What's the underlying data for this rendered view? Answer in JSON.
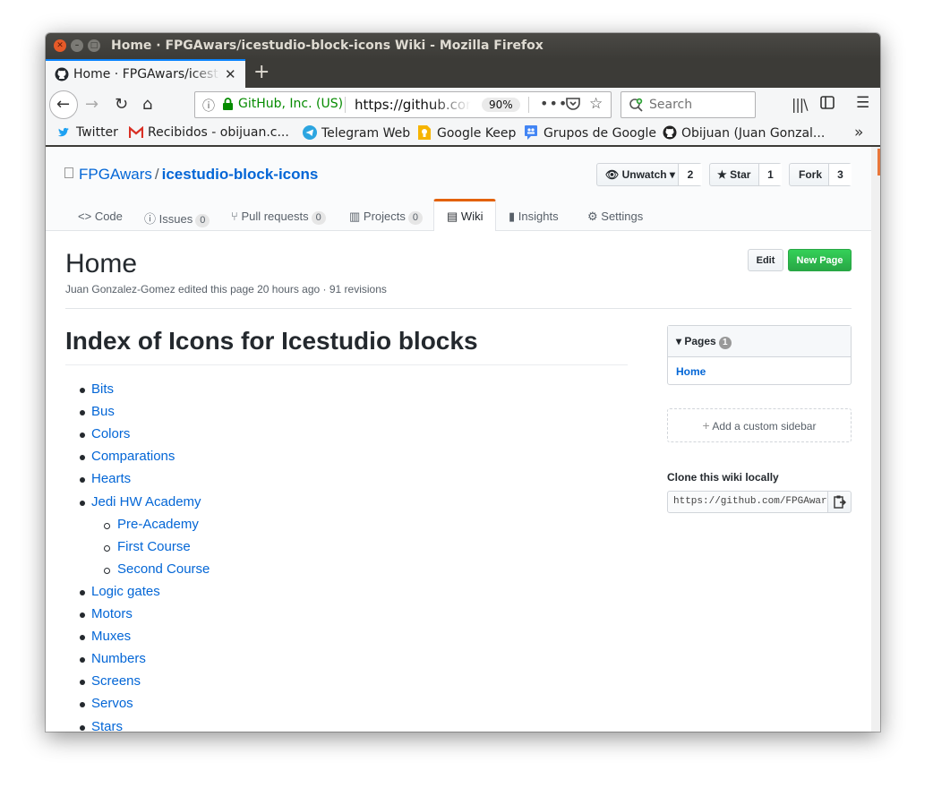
{
  "window": {
    "title": "Home · FPGAwars/icestudio-block-icons Wiki - Mozilla Firefox"
  },
  "tab": {
    "label": "Home · FPGAwars/icestudio-block-icons Wiki",
    "close_glyph": "✕",
    "new_tab_glyph": "+"
  },
  "navbar": {
    "identity": "GitHub, Inc. (US)",
    "url": "https://github.com/FPGAwars/icestudio-block-icons/wiki",
    "zoom": "90%",
    "search_placeholder": "Search"
  },
  "bookmarks": [
    {
      "label": "Twitter",
      "icon": "twitter-icon",
      "color": "#1da1f2"
    },
    {
      "label": "Recibidos - obijuan.c...",
      "icon": "gmail-icon",
      "color": "#d93025"
    },
    {
      "label": "Telegram Web",
      "icon": "telegram-icon",
      "color": "#2ca5e0"
    },
    {
      "label": "Google Keep",
      "icon": "keep-icon",
      "color": "#f6b400"
    },
    {
      "label": "Grupos de Google",
      "icon": "groups-icon",
      "color": "#4285f4"
    },
    {
      "label": "Obijuan (Juan Gonzal...",
      "icon": "github-icon",
      "color": "#222222"
    }
  ],
  "repo": {
    "owner": "FPGAwars",
    "separator": "/",
    "name": "icestudio-block-icons",
    "unwatch_label": "Unwatch ▾",
    "watch_count": "2",
    "star_label": "Star",
    "star_count": "1",
    "fork_label": "Fork",
    "fork_count": "3"
  },
  "reponav": [
    {
      "label": "Code",
      "counter": null,
      "icon": "code-icon"
    },
    {
      "label": "Issues",
      "counter": "0",
      "icon": "issue-icon"
    },
    {
      "label": "Pull requests",
      "counter": "0",
      "icon": "pull-request-icon"
    },
    {
      "label": "Projects",
      "counter": "0",
      "icon": "project-icon"
    },
    {
      "label": "Wiki",
      "counter": null,
      "icon": "book-icon",
      "selected": true
    },
    {
      "label": "Insights",
      "counter": null,
      "icon": "graph-icon"
    },
    {
      "label": "Settings",
      "counter": null,
      "icon": "gear-icon"
    }
  ],
  "page": {
    "title": "Home",
    "meta": "Juan Gonzalez-Gomez edited this page 20 hours ago · 91 revisions",
    "edit_label": "Edit",
    "new_page_label": "New Page"
  },
  "wiki": {
    "heading": "Index of Icons for Icestudio blocks",
    "items": [
      {
        "label": "Bits",
        "level": 1
      },
      {
        "label": "Bus",
        "level": 1
      },
      {
        "label": "Colors",
        "level": 1
      },
      {
        "label": "Comparations",
        "level": 1
      },
      {
        "label": "Hearts",
        "level": 1
      },
      {
        "label": "Jedi HW Academy",
        "level": 1
      },
      {
        "label": "Pre-Academy",
        "level": 2
      },
      {
        "label": "First Course",
        "level": 2
      },
      {
        "label": "Second Course",
        "level": 2
      },
      {
        "label": "Logic gates",
        "level": 1
      },
      {
        "label": "Motors",
        "level": 1
      },
      {
        "label": "Muxes",
        "level": 1
      },
      {
        "label": "Numbers",
        "level": 1
      },
      {
        "label": "Screens",
        "level": 1
      },
      {
        "label": "Servos",
        "level": 1
      },
      {
        "label": "Stars",
        "level": 1
      }
    ]
  },
  "sidebar": {
    "pages_label": "Pages",
    "pages_count": "1",
    "pages": [
      "Home"
    ],
    "custom_sidebar_label": "Add a custom sidebar",
    "clone_heading": "Clone this wiki locally",
    "clone_url": "https://github.com/FPGAwars/icestudio-block-icons.wiki.git"
  },
  "colors": {
    "link": "#0366d6",
    "new_page_green": "#28a745",
    "selected_tab_accent": "#e36209",
    "identity_green": "#058b00"
  }
}
